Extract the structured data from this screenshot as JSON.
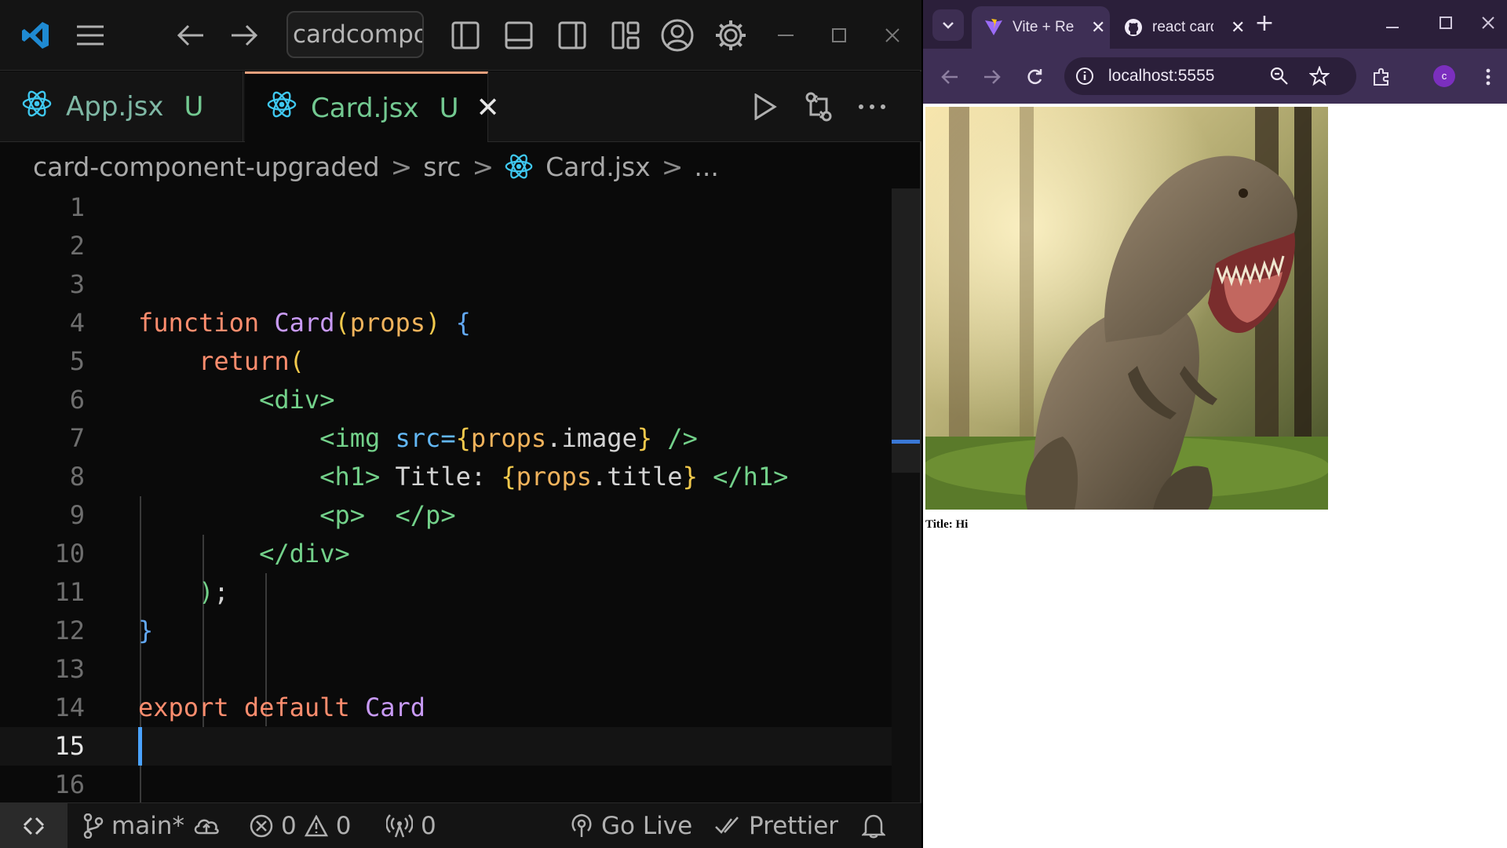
{
  "vscode": {
    "command_center": "cardcompor",
    "tabs": [
      {
        "label": "App.jsx",
        "status": "U"
      },
      {
        "label": "Card.jsx",
        "status": "U",
        "close": "✕"
      }
    ],
    "breadcrumb": {
      "root": "card-component-upgraded",
      "sep": ">",
      "folder": "src",
      "file": "Card.jsx",
      "more": "..."
    },
    "line_numbers": [
      "1",
      "2",
      "3",
      "4",
      "5",
      "6",
      "7",
      "8",
      "9",
      "10",
      "11",
      "12",
      "13",
      "14",
      "15",
      "16"
    ],
    "code": {
      "l4": {
        "kw": "function",
        "fn": "Card",
        "p1": "(",
        "prm": "props",
        "p2": ")",
        "brace": "{"
      },
      "l5": {
        "kw": "return",
        "paren": "("
      },
      "l6": {
        "tag": "<div>"
      },
      "l7": {
        "open": "<img",
        "attr": "src=",
        "b1": "{",
        "expr": "props",
        "dot": ".",
        "prop": "image",
        "b2": "}",
        "close": "/>"
      },
      "l8": {
        "open": "<h1>",
        "text": "Title:",
        "b1": "{",
        "expr": "props",
        "dot": ".",
        "prop": "title",
        "b2": "}",
        "close": "</h1>"
      },
      "l9": {
        "open": "<p>",
        "close": "</p>"
      },
      "l10": {
        "tag": "</div>"
      },
      "l11": {
        "paren": ")",
        "semi": ";"
      },
      "l12": {
        "brace": "}"
      },
      "l14": {
        "kw1": "export",
        "kw2": "default",
        "fn": "Card"
      }
    },
    "status": {
      "branch": "main*",
      "errors": "0",
      "warnings": "0",
      "ports": "0",
      "go_live": "Go Live",
      "prettier": "Prettier"
    }
  },
  "browser": {
    "tabs": [
      {
        "title": "Vite + React"
      },
      {
        "title": "react card"
      }
    ],
    "url": "localhost:5555",
    "avatar_letter": "c",
    "page_heading": "Title: Hi"
  },
  "colors": {
    "accent_tab_top": "#e8a07d",
    "git_untracked": "#73c991",
    "browser_frame": "#3e2f55",
    "cursor": "#4aa3ff"
  }
}
